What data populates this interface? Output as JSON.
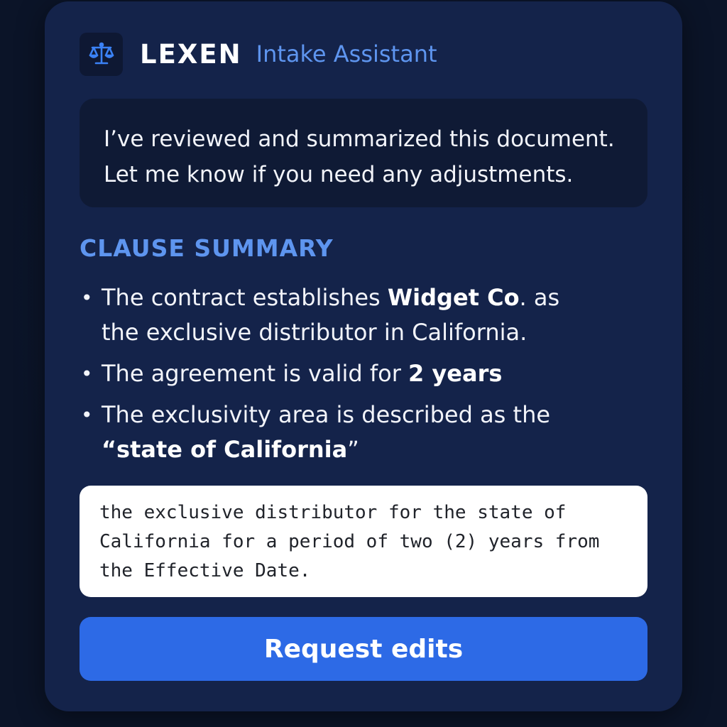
{
  "header": {
    "logo_icon": "scales-of-justice-icon",
    "brand": "LEXEN",
    "subtitle": "Intake Assistant"
  },
  "message": {
    "line1": "I’ve reviewed and summarized this document.",
    "line2": "Let me know if you need any adjustments."
  },
  "summary": {
    "title": "CLAUSE SUMMARY",
    "items": [
      {
        "pre": "The contract establishes ",
        "bold": "Widget Co",
        "post": ". as the exclusive distributor in California."
      },
      {
        "pre": "The agreement is valid for ",
        "bold": "2 years",
        "post": ""
      },
      {
        "pre": "The exclusivity area is described as the ",
        "bold": "“state of California",
        "post": "”"
      }
    ]
  },
  "excerpt": {
    "text": "the exclusive distributor for the state of California for a period of two (2) years from the Effective Date."
  },
  "actions": {
    "request_edits": "Request edits"
  },
  "colors": {
    "background": "#0c1529",
    "card": "#14234a",
    "accent": "#5e95ef",
    "button": "#2d6ae6"
  }
}
